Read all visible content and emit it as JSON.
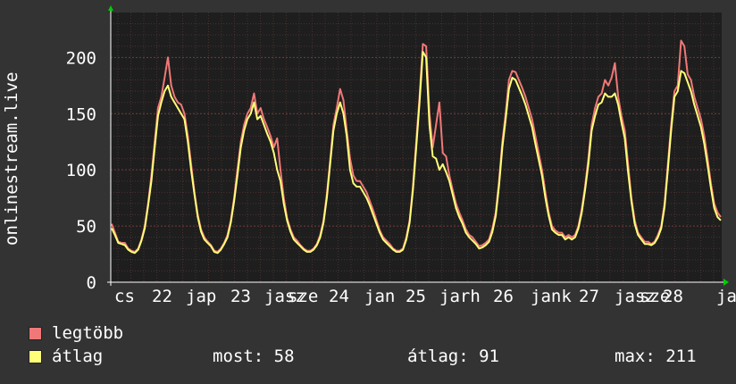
{
  "colors": {
    "background": "#333333",
    "plot_background": "#1e1e1e",
    "grid_major": "#7a3a3a",
    "grid_minor": "#4a3030",
    "axis": "#ffffff",
    "max_series": "#f07878",
    "avg_series": "#ffff78",
    "arrow": "#00cc00"
  },
  "chart_data": {
    "type": "line",
    "ylabel": "onlinestream.live",
    "ylim": [
      0,
      240
    ],
    "y_ticks": [
      "0",
      "50",
      "100",
      "150",
      "200"
    ],
    "x_tick_labels": [
      "cs",
      "22",
      "jap",
      "23",
      "jasz",
      "sze",
      "24",
      "jan",
      "25",
      "jarh",
      "26",
      "jank",
      "27",
      "jasz",
      "sze",
      "28",
      "ja"
    ],
    "grid": true,
    "x_label_note": "hourly samples starting around day 21 evening",
    "series": [
      {
        "name": "legtöbb",
        "values": [
          52,
          44,
          36,
          35,
          35,
          30,
          28,
          27,
          30,
          38,
          50,
          70,
          95,
          125,
          155,
          165,
          182,
          200,
          175,
          165,
          160,
          158,
          150,
          130,
          105,
          80,
          60,
          47,
          40,
          36,
          33,
          28,
          27,
          30,
          35,
          42,
          55,
          75,
          100,
          125,
          140,
          150,
          155,
          168,
          150,
          155,
          145,
          138,
          130,
          120,
          128,
          100,
          75,
          57,
          47,
          40,
          37,
          33,
          30,
          28,
          28,
          30,
          34,
          42,
          55,
          78,
          108,
          140,
          155,
          172,
          162,
          135,
          110,
          95,
          90,
          90,
          85,
          80,
          72,
          64,
          55,
          46,
          40,
          37,
          34,
          30,
          28,
          28,
          30,
          40,
          55,
          85,
          125,
          165,
          212,
          210,
          150,
          120,
          140,
          160,
          115,
          112,
          95,
          82,
          70,
          62,
          55,
          47,
          42,
          40,
          36,
          32,
          33,
          35,
          38,
          48,
          62,
          90,
          125,
          150,
          180,
          188,
          187,
          180,
          173,
          165,
          155,
          145,
          130,
          115,
          100,
          80,
          62,
          50,
          46,
          44,
          44,
          40,
          42,
          40,
          42,
          50,
          65,
          85,
          110,
          140,
          155,
          165,
          168,
          180,
          175,
          182,
          195,
          165,
          148,
          135,
          105,
          75,
          55,
          44,
          40,
          36,
          36,
          34,
          36,
          42,
          50,
          70,
          105,
          140,
          170,
          175,
          215,
          210,
          185,
          180,
          165,
          155,
          145,
          130,
          110,
          88,
          70,
          62,
          58
        ],
        "legend_stat_label": "legtöbb"
      },
      {
        "name": "átlag",
        "values": [
          48,
          42,
          35,
          34,
          33,
          29,
          27,
          26,
          29,
          37,
          48,
          68,
          90,
          120,
          148,
          160,
          170,
          175,
          165,
          160,
          155,
          150,
          145,
          125,
          100,
          78,
          58,
          45,
          38,
          35,
          32,
          27,
          26,
          29,
          34,
          40,
          53,
          72,
          95,
          120,
          135,
          145,
          150,
          160,
          145,
          148,
          140,
          132,
          125,
          115,
          100,
          90,
          70,
          55,
          45,
          38,
          35,
          32,
          29,
          27,
          27,
          29,
          33,
          40,
          53,
          75,
          105,
          135,
          150,
          160,
          150,
          130,
          100,
          88,
          85,
          85,
          80,
          75,
          68,
          60,
          52,
          44,
          38,
          35,
          32,
          29,
          27,
          27,
          29,
          38,
          53,
          82,
          120,
          160,
          205,
          200,
          140,
          112,
          110,
          100,
          105,
          98,
          90,
          78,
          66,
          58,
          52,
          44,
          40,
          37,
          34,
          30,
          31,
          33,
          36,
          45,
          59,
          86,
          120,
          145,
          172,
          182,
          180,
          173,
          166,
          158,
          148,
          138,
          123,
          109,
          95,
          75,
          59,
          47,
          44,
          42,
          42,
          38,
          40,
          38,
          40,
          48,
          62,
          82,
          105,
          135,
          148,
          158,
          160,
          168,
          165,
          165,
          168,
          158,
          142,
          128,
          98,
          72,
          52,
          42,
          38,
          34,
          34,
          33,
          35,
          40,
          48,
          67,
          100,
          135,
          165,
          170,
          188,
          186,
          178,
          170,
          158,
          148,
          138,
          123,
          104,
          84,
          66,
          58,
          55
        ]
      }
    ]
  },
  "legend": {
    "items": [
      {
        "label": "legtöbb",
        "color": "#f07878"
      },
      {
        "label": "átlag",
        "color": "#ffff78"
      }
    ],
    "stats": {
      "current": "most: 58",
      "average": "átlag: 91",
      "max": "max: 211"
    }
  }
}
